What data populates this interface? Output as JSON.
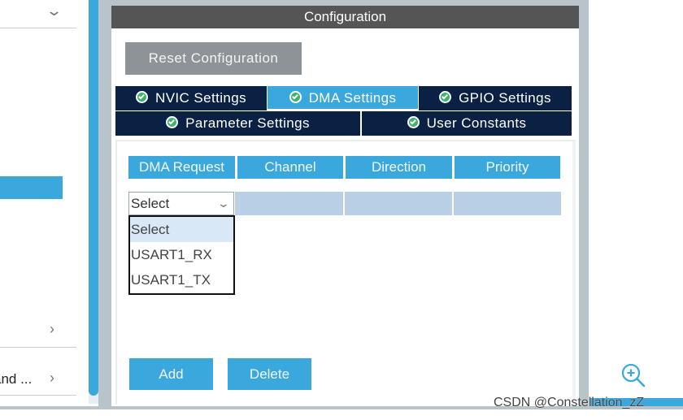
{
  "left_panel": {
    "truncated_item": "and ...",
    "icons": [
      "chevron-down-icon",
      "chevron-right-icon",
      "chevron-right-icon"
    ]
  },
  "config": {
    "title": "Configuration",
    "reset_label": "Reset Configuration",
    "tabs": [
      {
        "label": "NVIC Settings",
        "active": false
      },
      {
        "label": "DMA Settings",
        "active": true
      },
      {
        "label": "GPIO Settings",
        "active": false
      },
      {
        "label": "Parameter Settings",
        "active": false
      },
      {
        "label": "User Constants",
        "active": false
      }
    ],
    "table": {
      "headers": [
        "DMA Request",
        "Channel",
        "Direction",
        "Priority"
      ],
      "row": {
        "dma_request": "Select",
        "channel": "",
        "direction": "",
        "priority": ""
      }
    },
    "dropdown": {
      "options": [
        "Select",
        "USART1_RX",
        "USART1_TX"
      ],
      "highlighted": "Select"
    },
    "add_label": "Add",
    "delete_label": "Delete"
  },
  "watermark": "CSDN @Constellation_zZ",
  "colors": {
    "accent": "#3aa8dc",
    "tab_dark": "#0a2144",
    "header": "#555555",
    "row_fill": "#b8cfe6",
    "check_green": "#3db36b"
  }
}
